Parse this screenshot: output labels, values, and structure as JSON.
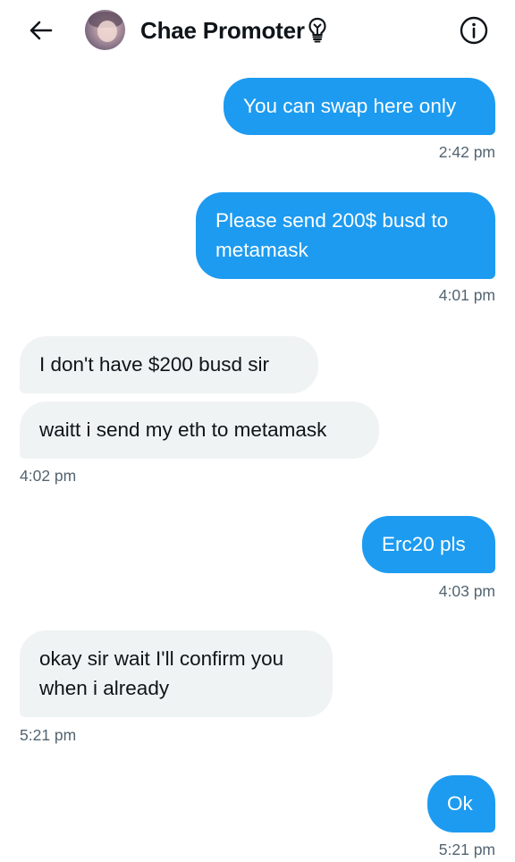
{
  "header": {
    "title": "Chae Promoter",
    "title_badge_icon": "lightbulb-icon",
    "back_icon": "arrow-left-icon",
    "info_icon": "info-circle-icon"
  },
  "colors": {
    "outgoing_bubble": "#1d9bf0",
    "incoming_bubble": "#eff3f4",
    "timestamp": "#536471"
  },
  "messages": [
    {
      "direction": "outgoing",
      "text": "You can swap here only"
    },
    {
      "direction": "outgoing",
      "text": "Please send 200$ busd to metamask"
    },
    {
      "direction": "incoming",
      "text": "I don't have $200 busd sir"
    },
    {
      "direction": "incoming",
      "text": "waitt i send my eth to metamask"
    },
    {
      "direction": "outgoing",
      "text": "Erc20 pls"
    },
    {
      "direction": "incoming",
      "text": "okay sir wait I'll confirm you when i already"
    },
    {
      "direction": "outgoing",
      "text": "Ok"
    }
  ],
  "timestamps": [
    "2:42 pm",
    "4:01 pm",
    "4:02 pm",
    "4:03 pm",
    "5:21 pm",
    "5:21 pm"
  ]
}
